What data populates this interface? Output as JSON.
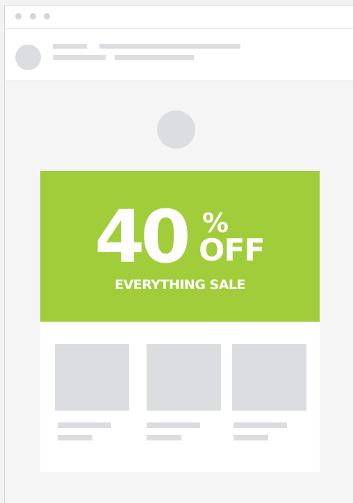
{
  "window": {
    "controls": [
      "window-dot",
      "window-dot",
      "window-dot"
    ]
  },
  "promo": {
    "number": "40",
    "percent_sign": "%",
    "off_label": "OFF",
    "subtitle": "EVERYTHING SALE",
    "accent_color": "#a2cd3a"
  },
  "products": [
    {
      "image": "placeholder"
    },
    {
      "image": "placeholder"
    },
    {
      "image": "placeholder"
    }
  ]
}
